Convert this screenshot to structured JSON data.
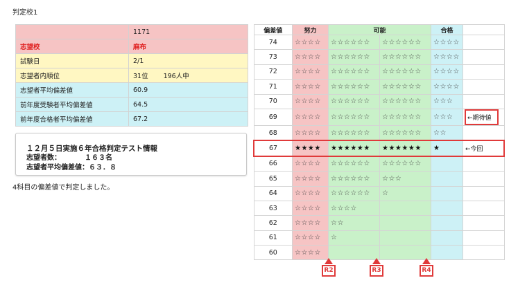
{
  "page_label": "判定校1",
  "school_info": {
    "code": "1171",
    "school_label": "志望校",
    "school_name": "麻布",
    "exam_date_label": "試験日",
    "exam_date": "2/1",
    "rank_label": "志望者内順位",
    "rank": "31位",
    "rank_total": "196人中",
    "avg_dev_label": "志望者平均偏差値",
    "avg_dev": "60.9",
    "prev_exam_label": "前年度受験者平均偏差値",
    "prev_exam": "64.5",
    "prev_pass_label": "前年度合格者平均偏差値",
    "prev_pass": "67.2"
  },
  "info_box": {
    "title": "１２月５日実施６年合格判定テスト情報",
    "applicants_label": "志望者数：",
    "applicants": "１６３名",
    "avg_label": "志望者平均偏差値：",
    "avg": "６３．８"
  },
  "note": "4科目の偏差値で判定しました。",
  "judge_table": {
    "headers": [
      "偏差値",
      "努力",
      "可能",
      "合格"
    ],
    "rows": [
      {
        "dev": "74",
        "effort": "☆☆☆☆",
        "p1": "☆☆☆☆☆☆",
        "p2": "☆☆☆☆☆☆",
        "pass": "☆☆☆☆",
        "extra": ""
      },
      {
        "dev": "73",
        "effort": "☆☆☆☆",
        "p1": "☆☆☆☆☆☆",
        "p2": "☆☆☆☆☆☆",
        "pass": "☆☆☆☆",
        "extra": ""
      },
      {
        "dev": "72",
        "effort": "☆☆☆☆",
        "p1": "☆☆☆☆☆☆",
        "p2": "☆☆☆☆☆☆",
        "pass": "☆☆☆☆",
        "extra": ""
      },
      {
        "dev": "71",
        "effort": "☆☆☆☆",
        "p1": "☆☆☆☆☆☆",
        "p2": "☆☆☆☆☆☆",
        "pass": "☆☆☆☆",
        "extra": ""
      },
      {
        "dev": "70",
        "effort": "☆☆☆☆",
        "p1": "☆☆☆☆☆☆",
        "p2": "☆☆☆☆☆☆",
        "pass": "☆☆☆",
        "extra": ""
      },
      {
        "dev": "69",
        "effort": "☆☆☆☆",
        "p1": "☆☆☆☆☆☆",
        "p2": "☆☆☆☆☆☆",
        "pass": "☆☆☆",
        "extra": "←期待値"
      },
      {
        "dev": "68",
        "effort": "☆☆☆☆",
        "p1": "☆☆☆☆☆☆",
        "p2": "☆☆☆☆☆☆",
        "pass": "☆☆",
        "extra": ""
      },
      {
        "dev": "67",
        "effort": "★★★★",
        "p1": "★★★★★★",
        "p2": "★★★★★★",
        "pass": "★",
        "extra": "←今回"
      },
      {
        "dev": "66",
        "effort": "☆☆☆☆",
        "p1": "☆☆☆☆☆☆",
        "p2": "☆☆☆☆☆☆",
        "pass": "",
        "extra": ""
      },
      {
        "dev": "65",
        "effort": "☆☆☆☆",
        "p1": "☆☆☆☆☆☆",
        "p2": "☆☆☆",
        "pass": "",
        "extra": ""
      },
      {
        "dev": "64",
        "effort": "☆☆☆☆",
        "p1": "☆☆☆☆☆☆",
        "p2": "☆",
        "pass": "",
        "extra": ""
      },
      {
        "dev": "63",
        "effort": "☆☆☆☆",
        "p1": "☆☆☆☆",
        "p2": "",
        "pass": "",
        "extra": ""
      },
      {
        "dev": "62",
        "effort": "☆☆☆☆",
        "p1": "☆☆",
        "p2": "",
        "pass": "",
        "extra": ""
      },
      {
        "dev": "61",
        "effort": "☆☆☆☆",
        "p1": "☆",
        "p2": "",
        "pass": "",
        "extra": ""
      },
      {
        "dev": "60",
        "effort": "☆☆☆☆",
        "p1": "",
        "p2": "",
        "pass": "",
        "extra": ""
      }
    ]
  },
  "markers": [
    "R2",
    "R3",
    "R4"
  ],
  "colors": {
    "accent_red": "#e03a3a",
    "effort_pink": "#f6c4c4",
    "possible_green": "#c9f1c9",
    "pass_cyan": "#cdf1f6",
    "info_yellow": "#fff7c2"
  }
}
